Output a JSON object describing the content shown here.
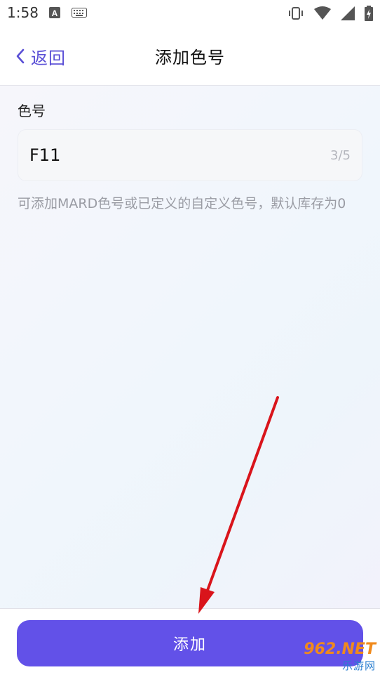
{
  "status_bar": {
    "time": "1:58",
    "icons_left": [
      "font-a-icon",
      "keyboard-icon"
    ],
    "icons_right": [
      "vibrate-icon",
      "wifi-icon",
      "signal-icon",
      "battery-charging-icon"
    ]
  },
  "header": {
    "back_label": "返回",
    "title": "添加色号"
  },
  "form": {
    "label": "色号",
    "input_value": "F11",
    "counter": "3/5",
    "hint": "可添加MARD色号或已定义的自定义色号，默认库存为0"
  },
  "footer": {
    "add_label": "添加"
  },
  "watermark": {
    "line1": "962.NET",
    "line2": "乐游网"
  },
  "colors": {
    "accent": "#6251e8",
    "back_link": "#5a4fd6",
    "annotation_arrow": "#d9141b"
  }
}
